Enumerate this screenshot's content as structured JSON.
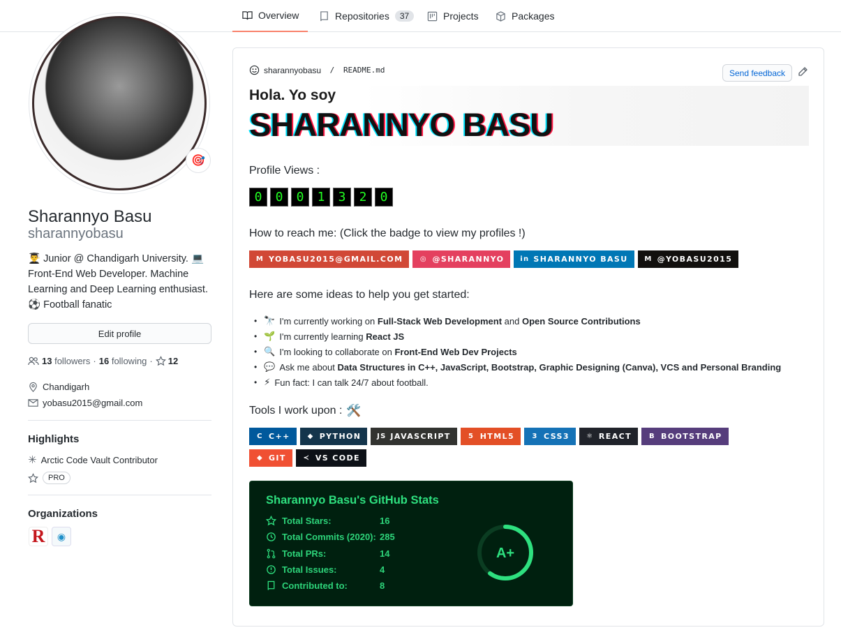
{
  "tabs": [
    {
      "label": "Overview",
      "icon": "book-icon",
      "active": true
    },
    {
      "label": "Repositories",
      "icon": "repo-icon",
      "count": "37"
    },
    {
      "label": "Projects",
      "icon": "project-icon"
    },
    {
      "label": "Packages",
      "icon": "package-icon"
    }
  ],
  "profile": {
    "full_name": "Sharannyo Basu",
    "login": "sharannyobasu",
    "status_emoji": "🎯",
    "bio_line1": "👨‍🎓 Junior @ Chandigarh University. 💻",
    "bio_line2": "Front-End Web Developer. Machine",
    "bio_line3": "Learning and Deep Learning enthusiast.",
    "bio_line4": "⚽ Football fanatic",
    "edit_label": "Edit profile",
    "followers": "13",
    "followers_label": "followers",
    "following": "16",
    "following_label": "following",
    "stars": "12",
    "location": "Chandigarh",
    "email": "yobasu2015@gmail.com",
    "highlights_title": "Highlights",
    "highlight_vault": "Arctic Code Vault Contributor",
    "highlight_pro": "PRO",
    "orgs_title": "Organizations"
  },
  "readme": {
    "user": "sharannyobasu",
    "sep": " / ",
    "file": "README.md",
    "feedback": "Send feedback",
    "hola": "Hola. Yo soy",
    "name_big": "SHARANNYO BASU",
    "views_label": "Profile Views :",
    "views_digits": [
      "0",
      "0",
      "0",
      "1",
      "3",
      "2",
      "0"
    ],
    "reach_label": "How to reach me: (Click the badge to view my profiles !)",
    "contact_badges": [
      {
        "label": "YOBASU2015@GMAIL.COM",
        "color": "#D14836",
        "icon": "M"
      },
      {
        "label": "@SHARANNYO",
        "color": "#E4405F",
        "icon": "◎"
      },
      {
        "label": "SHARANNYO BASU",
        "color": "#0077B5",
        "icon": "in"
      },
      {
        "label": "@YOBASU2015",
        "color": "#12100E",
        "icon": "M"
      }
    ],
    "ideas_label": "Here are some ideas to help you get started:",
    "ideas": [
      {
        "emoji": "🔭",
        "pre": "I'm currently working on ",
        "b1": "Full-Stack Web Development",
        "mid": " and ",
        "b2": "Open Source Contributions"
      },
      {
        "emoji": "🌱",
        "pre": "I'm currently learning ",
        "b1": "React JS",
        "mid": "",
        "b2": ""
      },
      {
        "emoji": "🔍",
        "pre": "I'm looking to collaborate on ",
        "b1": "Front-End Web Dev Projects",
        "mid": "",
        "b2": ""
      },
      {
        "emoji": "💬",
        "pre": "Ask me about ",
        "b1": "Data Structures in C++, JavaScript, Bootstrap, Graphic Designing (Canva), VCS and Personal Branding",
        "mid": "",
        "b2": ""
      },
      {
        "emoji": "⚡",
        "pre": "Fun fact: I can talk 24/7 about football.",
        "b1": "",
        "mid": "",
        "b2": ""
      }
    ],
    "tools_label": "Tools I work upon :",
    "tools_emoji": "🛠️",
    "tool_badges": [
      {
        "label": "C++",
        "color": "#00599C",
        "icon": "C"
      },
      {
        "label": "PYTHON",
        "color": "#14354C",
        "icon": "◆"
      },
      {
        "label": "JAVASCRIPT",
        "color": "#323330",
        "icon": "JS"
      },
      {
        "label": "HTML5",
        "color": "#E34F26",
        "icon": "5"
      },
      {
        "label": "CSS3",
        "color": "#1572B6",
        "icon": "3"
      },
      {
        "label": "REACT",
        "color": "#20232A",
        "icon": "⚛"
      },
      {
        "label": "BOOTSTRAP",
        "color": "#563D7C",
        "icon": "B"
      },
      {
        "label": "GIT",
        "color": "#F05033",
        "icon": "◆"
      },
      {
        "label": "VS CODE",
        "color": "#0D1117",
        "icon": "≺"
      }
    ],
    "stats": {
      "title": "Sharannyo Basu's GitHub Stats",
      "rows": [
        {
          "label": "Total Stars:",
          "value": "16",
          "icon": "star-icon"
        },
        {
          "label": "Total Commits (2020):",
          "value": "285",
          "icon": "history-icon"
        },
        {
          "label": "Total PRs:",
          "value": "14",
          "icon": "pr-icon"
        },
        {
          "label": "Total Issues:",
          "value": "4",
          "icon": "issue-icon"
        },
        {
          "label": "Contributed to:",
          "value": "8",
          "icon": "repo-icon"
        }
      ],
      "grade": "A+",
      "grade_progress": 0.6,
      "accent": "#2ee07f",
      "bg": "#00200f"
    }
  }
}
